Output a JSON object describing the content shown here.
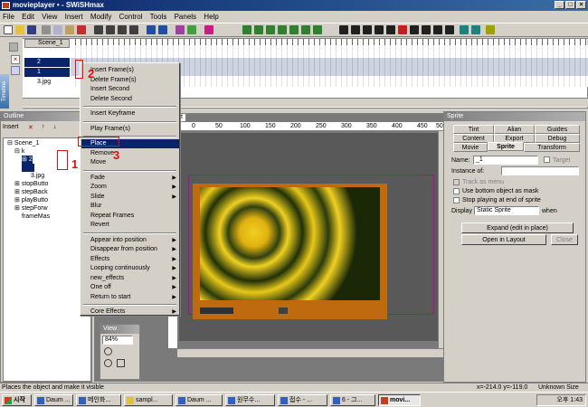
{
  "window": {
    "title": "movieplayer • - SWiSHmax"
  },
  "menubar": [
    "File",
    "Edit",
    "View",
    "Insert",
    "Modify",
    "Control",
    "Tools",
    "Panels",
    "Help"
  ],
  "timeline": {
    "label": "Timeline",
    "scene_label": "Scene_1",
    "rows": [
      "2",
      "1",
      "3.jpg"
    ]
  },
  "outline": {
    "title": "Outline",
    "insert_label": "Insert",
    "tree": [
      "Scene_1",
      "k",
      "2",
      "3.jpg",
      "stopButto",
      "stepBack",
      "playButto",
      "stepForw",
      "frameMas"
    ]
  },
  "stage": {
    "tab": "ut"
  },
  "ruler": [
    "0",
    "50",
    "100",
    "150",
    "200",
    "250",
    "300",
    "350",
    "400",
    "450",
    "500"
  ],
  "view": {
    "title": "View",
    "zoom": "84%"
  },
  "sprite_panel": {
    "title": "Sprite",
    "tabs_row1": [
      "Tint",
      "Alian",
      "Guides"
    ],
    "tabs_row2": [
      "Content",
      "Export",
      "Debug"
    ],
    "tabs_row3": [
      "Movie",
      "Sprite",
      "Transform"
    ],
    "name_label": "Name:",
    "name_value": "_1",
    "target_label": "Target",
    "instance_label": "Instance of:",
    "track_menu": "Track as menu",
    "use_bottom": "Use bottom object as mask",
    "stop_playing": "Stop playing at end of sprite",
    "display_label": "Display",
    "display_value": "Static Sprite",
    "when_label": "when",
    "expand_button": "Expand (edit in place)",
    "open_layout": "Open in Layout",
    "close_button": "Close"
  },
  "context_menu": {
    "items": [
      {
        "label": "Insert Frame(s)"
      },
      {
        "label": "Delete Frame(s)"
      },
      {
        "label": "Insert Second"
      },
      {
        "label": "Delete Second"
      },
      {
        "sep": true
      },
      {
        "label": "Insert Keyframe"
      },
      {
        "sep": true
      },
      {
        "label": "Play Frame(s)"
      },
      {
        "sep": true
      },
      {
        "label": "Place",
        "highlight": true
      },
      {
        "label": "Remove"
      },
      {
        "label": "Move"
      },
      {
        "sep": true
      },
      {
        "label": "Fade",
        "sub": true
      },
      {
        "label": "Zoom",
        "sub": true
      },
      {
        "label": "Slide",
        "sub": true
      },
      {
        "label": "Blur"
      },
      {
        "label": "Repeat Frames"
      },
      {
        "label": "Revert"
      },
      {
        "sep": true
      },
      {
        "label": "Appear into position",
        "sub": true
      },
      {
        "label": "Disappear from position",
        "sub": true
      },
      {
        "label": "Effects",
        "sub": true
      },
      {
        "label": "Looping continuously",
        "sub": true
      },
      {
        "label": "new_effects",
        "sub": true
      },
      {
        "label": "One off",
        "sub": true
      },
      {
        "label": "Return to start",
        "sub": true
      },
      {
        "sep": true
      },
      {
        "label": "Core Effects",
        "sub": true
      }
    ]
  },
  "annotations": [
    "1",
    "2",
    "3"
  ],
  "statusbar": {
    "text": "Places the object and make it visible",
    "coords": "x=-214.0 y=-119.0",
    "size": "Unknown Size"
  },
  "taskbar": {
    "start": "시작",
    "tasks": [
      "Daum ...",
      "메인화...",
      "sampl...",
      "Daum ...",
      "원무수...",
      "접수 - ...",
      "6 - 그...",
      "movi..."
    ],
    "clock": "오후 1:43"
  },
  "colors": {
    "title_bg": "#0a246a",
    "menu_highlight": "#0a246a",
    "annotation": "#e01010",
    "frame_orange": "#c06a10"
  }
}
